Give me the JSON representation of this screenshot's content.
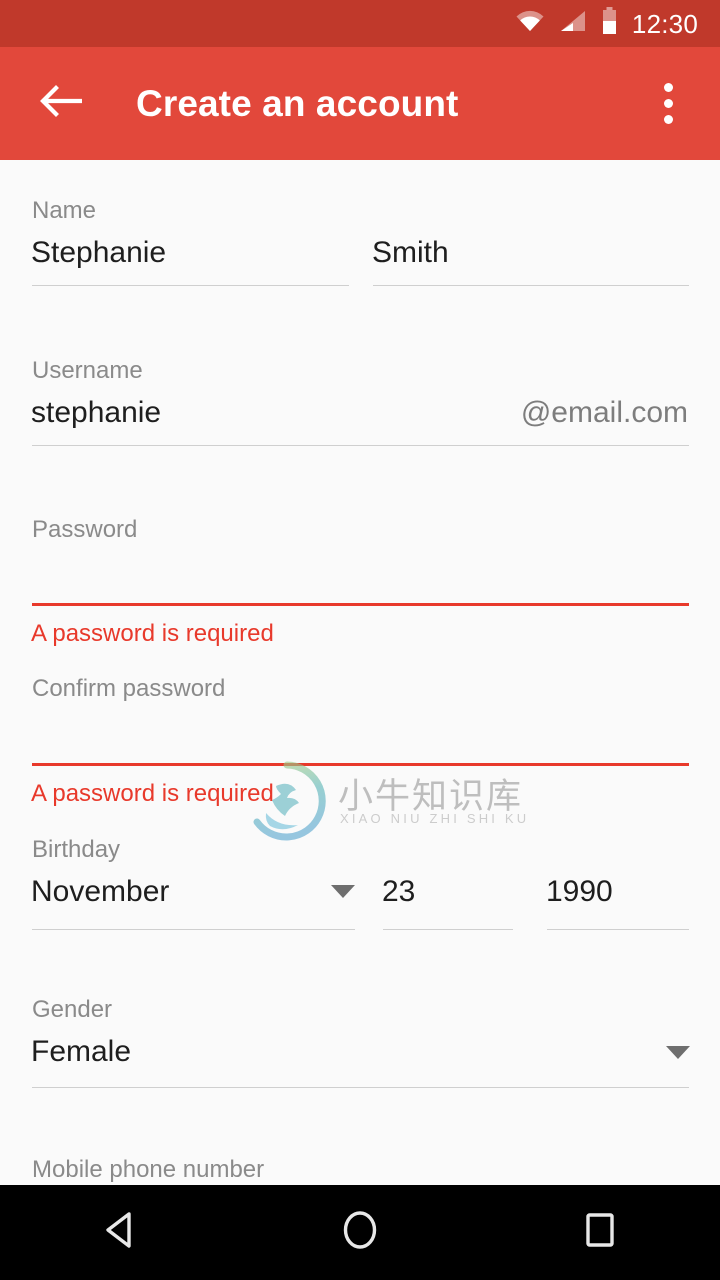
{
  "status_bar": {
    "time": "12:30",
    "icons": [
      "wifi-icon",
      "cell-signal-icon",
      "battery-icon"
    ],
    "background": "#c0392b"
  },
  "app_bar": {
    "title": "Create an account",
    "back_icon": "back-arrow-icon",
    "overflow_icon": "overflow-menu-icon",
    "background": "#e2483b"
  },
  "form": {
    "name": {
      "label": "Name",
      "first": "Stephanie",
      "last": "Smith"
    },
    "username": {
      "label": "Username",
      "value": "stephanie",
      "domain_suffix": "@email.com"
    },
    "password": {
      "label": "Password",
      "value": "",
      "error": "A password is required"
    },
    "confirm_password": {
      "label": "Confirm password",
      "value": "",
      "error": "A password is required"
    },
    "birthday": {
      "label": "Birthday",
      "month": "November",
      "day": "23",
      "year": "1990"
    },
    "gender": {
      "label": "Gender",
      "value": "Female"
    },
    "mobile_phone": {
      "label": "Mobile phone number"
    }
  },
  "watermark": {
    "text_cn": "小牛知识库",
    "text_en": "XIAO NIU ZHI SHI KU"
  },
  "nav_bar": {
    "back": "nav-back-icon",
    "home": "nav-home-icon",
    "recents": "nav-recents-icon"
  },
  "colors": {
    "primary": "#e2483b",
    "primary_dark": "#c0392b",
    "error": "#e8392b",
    "label": "#8a8a8a",
    "value": "#1e1e1e",
    "divider": "#cfcfcf",
    "background": "#fafafa"
  }
}
